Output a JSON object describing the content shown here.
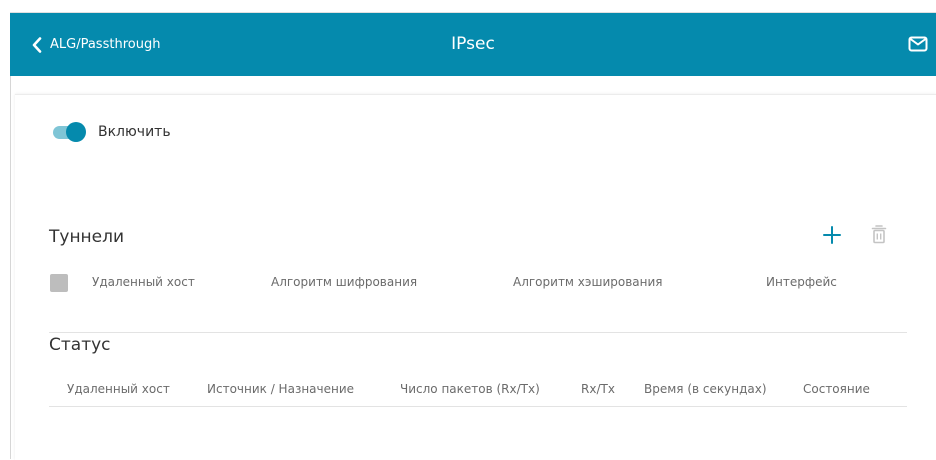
{
  "header": {
    "back_label": "ALG/Passthrough",
    "title": "IPsec",
    "back_icon": "chevron-left-icon",
    "mail_icon": "envelope-icon"
  },
  "toggle": {
    "label": "Включить",
    "enabled": true
  },
  "tunnels": {
    "title": "Туннели",
    "add_icon": "plus-icon",
    "delete_icon": "trash-icon",
    "columns": [
      "Удаленный хост",
      "Алгоритм шифрования",
      "Алгоритм хэширования",
      "Интерфейс"
    ]
  },
  "status": {
    "title": "Статус",
    "columns": [
      "Удаленный хост",
      "Источник / Назначение",
      "Число пакетов (Rx/Tx)",
      "Rx/Tx",
      "Время (в секундах)",
      "Состояние"
    ]
  },
  "colors": {
    "accent": "#058aad",
    "toggle_track": "#7fc5d6",
    "checkbox": "#bdbdbd"
  }
}
